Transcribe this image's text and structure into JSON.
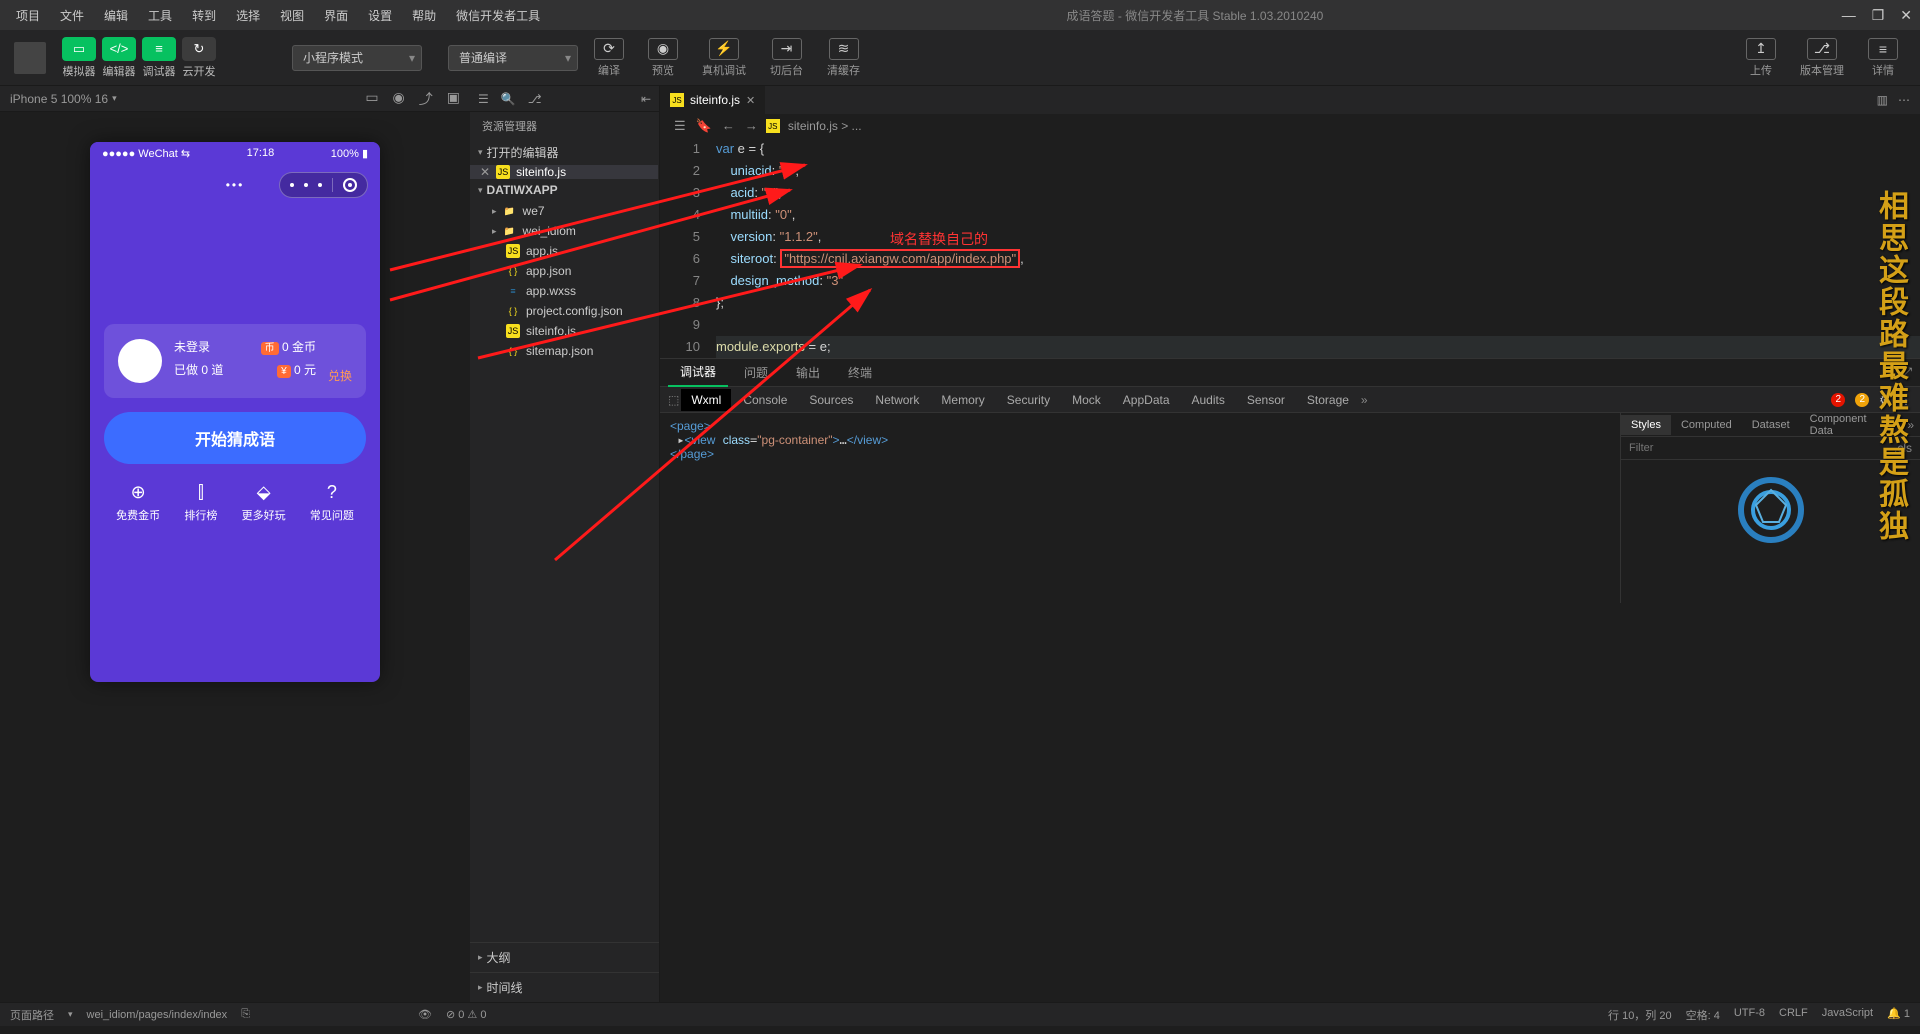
{
  "titlebar": {
    "menus": [
      "项目",
      "文件",
      "编辑",
      "工具",
      "转到",
      "选择",
      "视图",
      "界面",
      "设置",
      "帮助",
      "微信开发者工具"
    ],
    "title": "成语答题 - 微信开发者工具 Stable 1.03.2010240"
  },
  "toolbar": {
    "buttons": [
      {
        "label": "模拟器",
        "green": true,
        "glyph": "▭"
      },
      {
        "label": "编辑器",
        "green": true,
        "glyph": "</>"
      },
      {
        "label": "调试器",
        "green": true,
        "glyph": "≡"
      },
      {
        "label": "云开发",
        "green": false,
        "glyph": "↻"
      }
    ],
    "mode": "小程序模式",
    "compile": "普通编译",
    "actions": [
      {
        "label": "编译",
        "glyph": "⟳"
      },
      {
        "label": "预览",
        "glyph": "◉"
      },
      {
        "label": "真机调试",
        "glyph": "⚡"
      },
      {
        "label": "切后台",
        "glyph": "⇥"
      },
      {
        "label": "清缓存",
        "glyph": "≋"
      }
    ],
    "right": [
      {
        "label": "上传",
        "glyph": "↥"
      },
      {
        "label": "版本管理",
        "glyph": "⎇"
      },
      {
        "label": "详情",
        "glyph": "≡"
      }
    ]
  },
  "sim": {
    "device": "iPhone 5 100% 16",
    "status": {
      "carrier": "●●●●● WeChat ⇆",
      "time": "17:18",
      "battery": "100% ▮"
    },
    "card": {
      "name": "未登录",
      "done_label": "已做 0 道",
      "coin": "0 金币",
      "money": "0 元",
      "exchange": "兑换"
    },
    "start_btn": "开始猜成语",
    "nav": [
      {
        "ic": "⊕",
        "t": "免费金币"
      },
      {
        "ic": "⫿",
        "t": "排行榜"
      },
      {
        "ic": "⬙",
        "t": "更多好玩"
      },
      {
        "ic": "?",
        "t": "常见问题"
      }
    ]
  },
  "explorer": {
    "title": "资源管理器",
    "open_section": "打开的编辑器",
    "open_file": "siteinfo.js",
    "project": "DATIWXAPP",
    "folders": [
      "we7",
      "wei_idiom"
    ],
    "files": [
      {
        "n": "app.js",
        "k": "js"
      },
      {
        "n": "app.json",
        "k": "json"
      },
      {
        "n": "app.wxss",
        "k": "wxss"
      },
      {
        "n": "project.config.json",
        "k": "json"
      },
      {
        "n": "siteinfo.js",
        "k": "js"
      },
      {
        "n": "sitemap.json",
        "k": "json"
      }
    ],
    "outline": "大纲",
    "timeline": "时间线"
  },
  "editor": {
    "tab": "siteinfo.js",
    "crumb": "siteinfo.js > ...",
    "annotation": "域名替换自己的",
    "code": {
      "uniacid_k": "uniacid",
      "uniacid_v": "\"2\"",
      "acid_k": "acid",
      "acid_v": "\"2\"",
      "multiid_k": "multiid",
      "multiid_v": "\"0\"",
      "version_k": "version",
      "version_v": "\"1.1.2\"",
      "siteroot_k": "siteroot",
      "siteroot_v": "\"https://cnjl.axiangw.com/app/index.php\"",
      "design_k": "design_method",
      "design_v": "\"3\""
    },
    "module_line": "module.exports = e;"
  },
  "debug": {
    "tabs": [
      "调试器",
      "问题",
      "输出",
      "终端"
    ],
    "devtabs": [
      "Wxml",
      "Console",
      "Sources",
      "Network",
      "Memory",
      "Security",
      "Mock",
      "AppData",
      "Audits",
      "Sensor",
      "Storage"
    ],
    "err_count": "2",
    "warn_count": "2",
    "wxml_lines": {
      "l1": "<page>",
      "l2": "<view class=\"pg-container\">…</view>",
      "l3": "</page>"
    },
    "style_tabs": [
      "Styles",
      "Computed",
      "Dataset",
      "Component Data"
    ],
    "filter_placeholder": "Filter",
    "cls": ".cls"
  },
  "statusbar": {
    "path_label": "页面路径",
    "path": "wei_idiom/pages/index/index",
    "warn": "0",
    "err": "0",
    "pos": "行 10，列 20",
    "spaces": "空格: 4",
    "enc": "UTF-8",
    "eol": "CRLF",
    "lang": "JavaScript",
    "bell": "1"
  },
  "watermark": "相思这段路最难熬是孤独"
}
